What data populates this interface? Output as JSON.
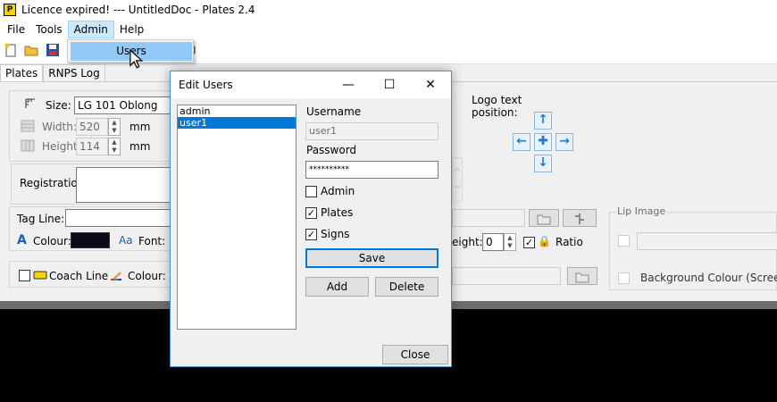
{
  "window": {
    "title": "Licence expired! --- UntitledDoc - Plates 2.4",
    "app_icon_letter": "P"
  },
  "menu": {
    "items": [
      "File",
      "Tools",
      "Admin",
      "Help"
    ]
  },
  "admin_menu": {
    "items": [
      "Users"
    ]
  },
  "tabs": [
    "Plates",
    "RNPS Log"
  ],
  "plates": {
    "size_label": "Size:",
    "size_value": "LG 101 Oblong",
    "width_label": "Width:",
    "width_value": "520",
    "height_label": "Height:",
    "height_value": "114",
    "unit": "mm",
    "registration_label": "Registration:",
    "registration_value": "",
    "tagline_label": "Tag Line:",
    "colour_label": "Colour:",
    "font_label": "Font:",
    "coach_line_label": "Coach Line",
    "coach_colour_label": "Colour:",
    "logo_text_position_label": "Logo text\nposition:",
    "height_partial_label": "eight:",
    "height_partial_value": "0",
    "ratio_label": "Ratio",
    "lip_image_label": "Lip Image",
    "background_colour_label": "Background Colour (Screen onl"
  },
  "dialog": {
    "title": "Edit Users",
    "users": [
      "admin",
      "user1"
    ],
    "selected_index": 1,
    "username_label": "Username",
    "username_value": "user1",
    "password_label": "Password",
    "password_value": "**********",
    "admin_label": "Admin",
    "admin_checked": false,
    "plates_label": "Plates",
    "plates_checked": true,
    "signs_label": "Signs",
    "signs_checked": true,
    "save_label": "Save",
    "add_label": "Add",
    "delete_label": "Delete",
    "close_label": "Close",
    "minimize_glyph": "—",
    "maximize_glyph": "☐",
    "close_glyph": "✕"
  },
  "colors": {
    "accent": "#0078d7",
    "menu_highlight": "#91c9f7",
    "colour_swatch": "#0a0a1a"
  }
}
